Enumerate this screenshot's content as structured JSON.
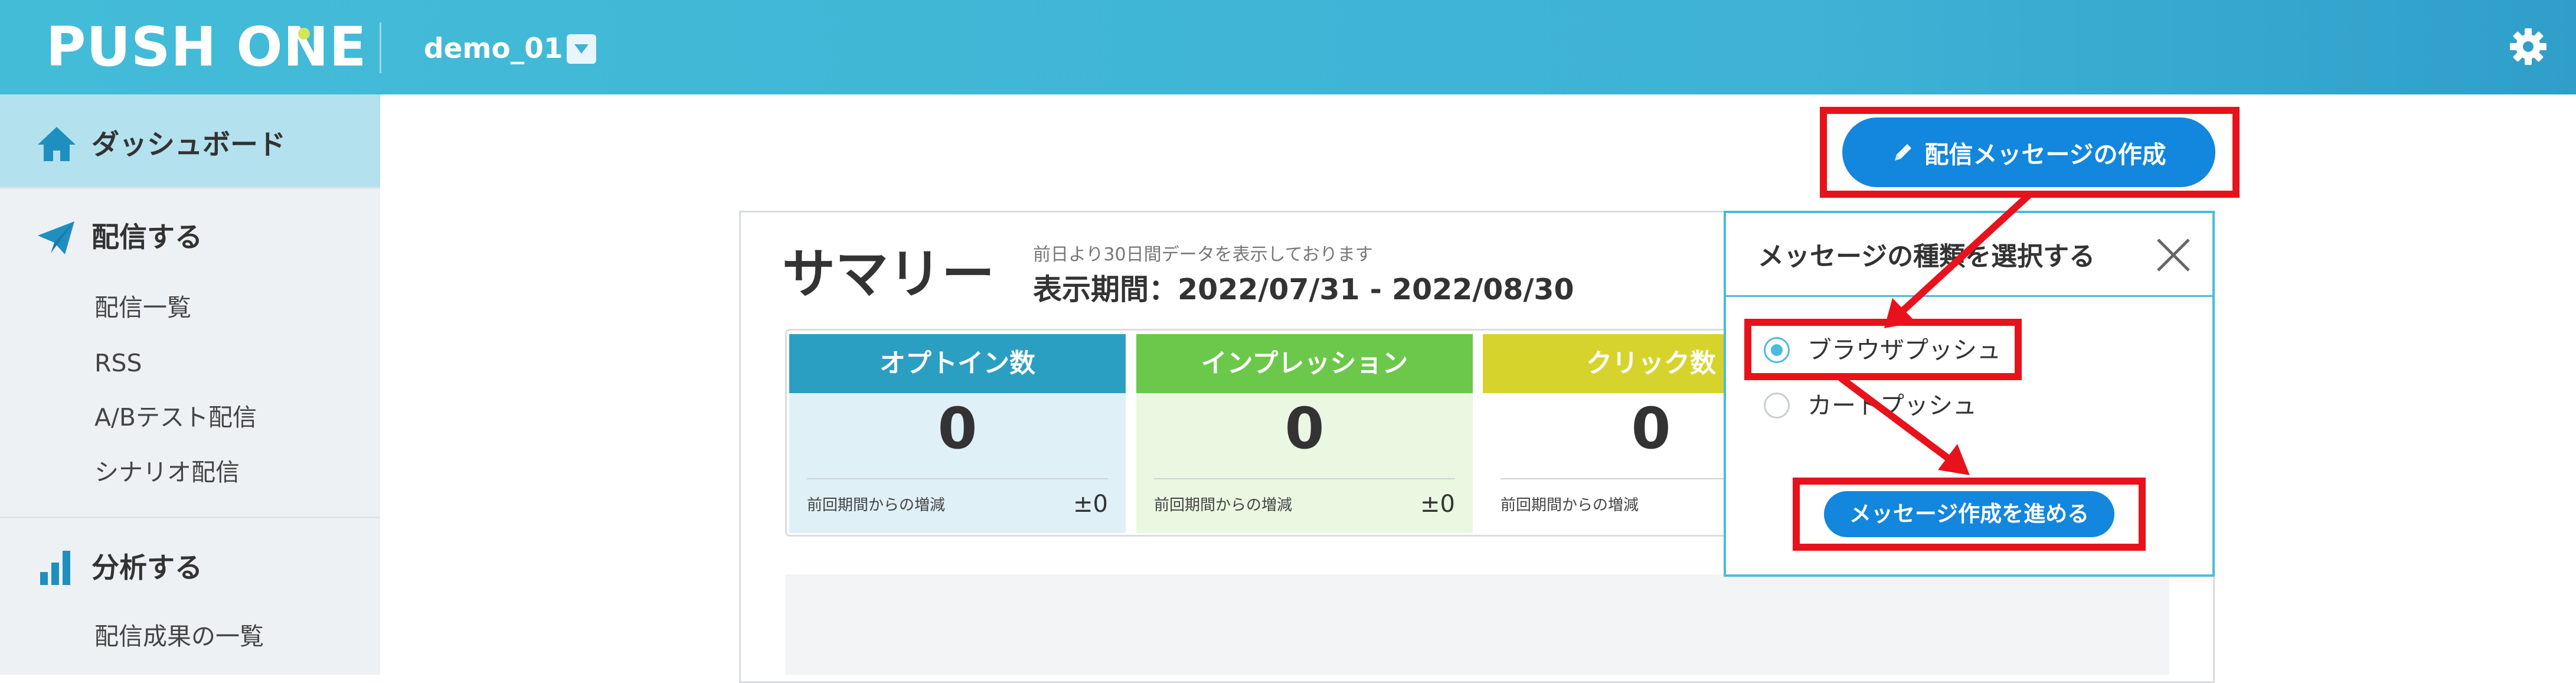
{
  "header": {
    "logo": "PUSH ONE",
    "account": "demo_01"
  },
  "sidebar": {
    "dashboard": "ダッシュボード",
    "deliver": {
      "label": "配信する",
      "items": [
        "配信一覧",
        "RSS",
        "A/Bテスト配信",
        "シナリオ配信"
      ]
    },
    "analyze": {
      "label": "分析する",
      "items": [
        "配信成果の一覧"
      ]
    }
  },
  "main": {
    "create_button": "配信メッセージの作成",
    "summary": {
      "title": "サマリー",
      "note": "前日より30日間データを表示しております",
      "period": "表示期間：2022/07/31 - 2022/08/30",
      "cards": [
        {
          "title": "オプトイン数",
          "value": "0",
          "caption": "前回期間からの増減",
          "delta": "±0",
          "head_color": "#2b9fc1",
          "body_color": "#dff0f6"
        },
        {
          "title": "インプレッション",
          "value": "0",
          "caption": "前回期間からの増減",
          "delta": "±0",
          "head_color": "#6cc84a",
          "body_color": "#eaf7e1"
        },
        {
          "title": "クリック数",
          "value": "0",
          "caption": "前回期間からの増減",
          "head_color": "#d6d42c",
          "body_color": "#ffffff"
        }
      ]
    }
  },
  "popup": {
    "title": "メッセージの種類を選択する",
    "options": [
      "ブラウザプッシュ",
      "カートプッシュ"
    ],
    "selected": "ブラウザプッシュ",
    "proceed_button": "メッセージ作成を進める"
  },
  "colors": {
    "header": "#3fb2d5",
    "primary_button": "#1386dd",
    "annotation": "#e8121c"
  }
}
